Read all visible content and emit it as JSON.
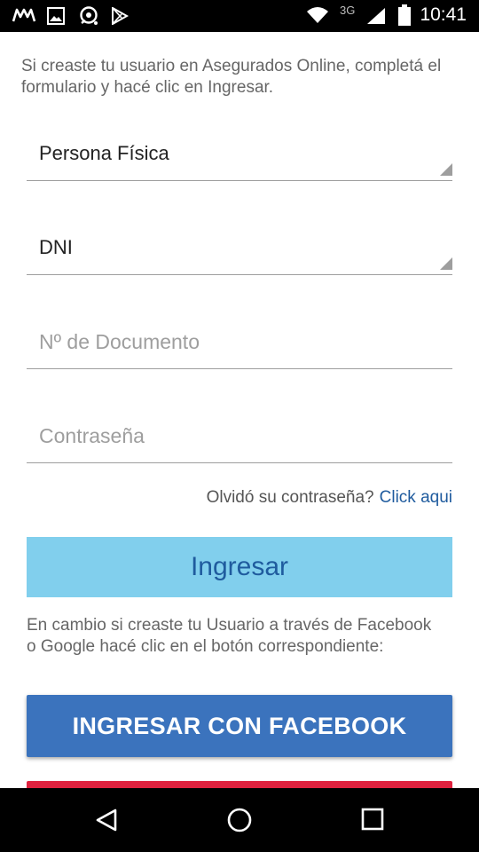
{
  "status_bar": {
    "network": "3G",
    "time": "10:41",
    "icons": [
      "motorola-icon",
      "gallery-icon",
      "chat-icon",
      "play-store-icon",
      "wifi-icon",
      "signal-icon",
      "battery-icon"
    ]
  },
  "form": {
    "intro": "Si creaste tu usuario en Asegurados Online, completá el formulario y hacé clic en Ingresar.",
    "person_type": "Persona Física",
    "doc_type": "DNI",
    "doc_number_placeholder": "Nº de Documento",
    "password_placeholder": "Contraseña",
    "forgot_question": "Olvidó su contraseña?",
    "forgot_link": "Click aqui",
    "submit_label": "Ingresar"
  },
  "social": {
    "intro": "En cambio si creaste tu Usuario a través de Facebook o Google hacé clic en el botón correspondiente:",
    "facebook_label": "INGRESAR CON FACEBOOK"
  },
  "colors": {
    "ingresar_bg": "#81cfed",
    "link": "#1f5b9e",
    "facebook": "#3b73bd",
    "google": "#e0223f"
  },
  "nav_bar": {
    "icons": [
      "back-icon",
      "home-icon",
      "recents-icon"
    ]
  }
}
